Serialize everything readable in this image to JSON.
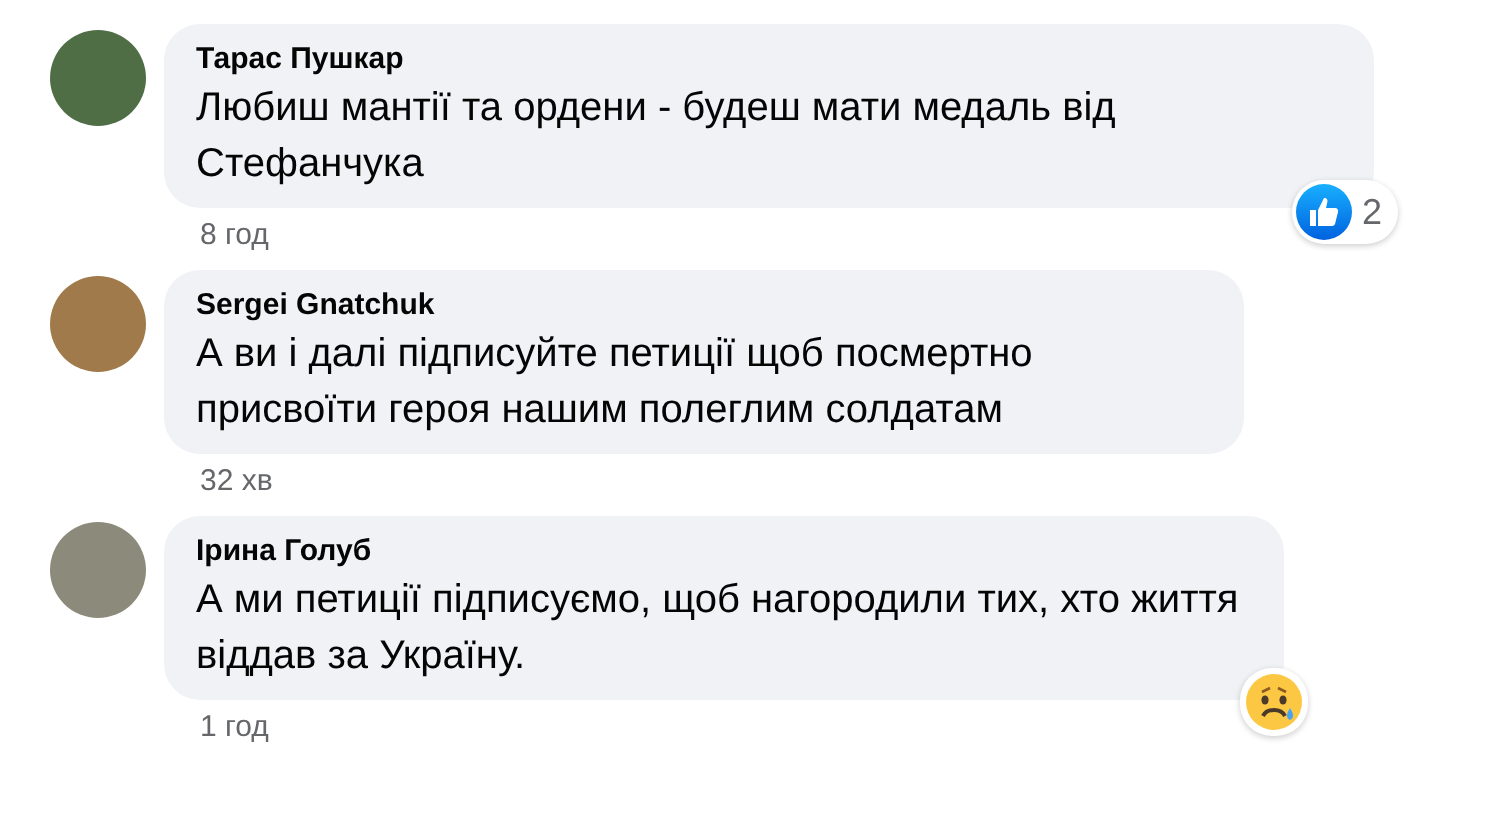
{
  "comments": [
    {
      "author": "Тарас Пушкар",
      "text": "Любиш мантії та ордени - будеш мати медаль від Стефанчука",
      "time": "8 год",
      "reaction": {
        "kind": "like",
        "count": "2"
      }
    },
    {
      "author": "Sergei Gnatchuk",
      "text": "А ви і далі підписуйте петиції щоб посмертно присвоїти героя нашим полеглим солдатам",
      "time": "32 хв"
    },
    {
      "author": "Ірина Голуб",
      "text": "А ми петиції підписуємо, щоб нагородили тих, хто життя віддав за Україну.",
      "time": "1 год",
      "reaction": {
        "kind": "sad"
      }
    }
  ]
}
